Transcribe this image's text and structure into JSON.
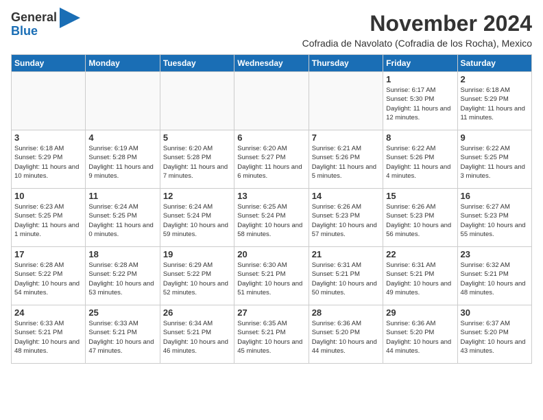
{
  "header": {
    "logo_general": "General",
    "logo_blue": "Blue",
    "title": "November 2024",
    "subtitle": "Cofradia de Navolato (Cofradia de los Rocha), Mexico"
  },
  "weekdays": [
    "Sunday",
    "Monday",
    "Tuesday",
    "Wednesday",
    "Thursday",
    "Friday",
    "Saturday"
  ],
  "weeks": [
    [
      {
        "day": "",
        "info": ""
      },
      {
        "day": "",
        "info": ""
      },
      {
        "day": "",
        "info": ""
      },
      {
        "day": "",
        "info": ""
      },
      {
        "day": "",
        "info": ""
      },
      {
        "day": "1",
        "info": "Sunrise: 6:17 AM\nSunset: 5:30 PM\nDaylight: 11 hours and 12 minutes."
      },
      {
        "day": "2",
        "info": "Sunrise: 6:18 AM\nSunset: 5:29 PM\nDaylight: 11 hours and 11 minutes."
      }
    ],
    [
      {
        "day": "3",
        "info": "Sunrise: 6:18 AM\nSunset: 5:29 PM\nDaylight: 11 hours and 10 minutes."
      },
      {
        "day": "4",
        "info": "Sunrise: 6:19 AM\nSunset: 5:28 PM\nDaylight: 11 hours and 9 minutes."
      },
      {
        "day": "5",
        "info": "Sunrise: 6:20 AM\nSunset: 5:28 PM\nDaylight: 11 hours and 7 minutes."
      },
      {
        "day": "6",
        "info": "Sunrise: 6:20 AM\nSunset: 5:27 PM\nDaylight: 11 hours and 6 minutes."
      },
      {
        "day": "7",
        "info": "Sunrise: 6:21 AM\nSunset: 5:26 PM\nDaylight: 11 hours and 5 minutes."
      },
      {
        "day": "8",
        "info": "Sunrise: 6:22 AM\nSunset: 5:26 PM\nDaylight: 11 hours and 4 minutes."
      },
      {
        "day": "9",
        "info": "Sunrise: 6:22 AM\nSunset: 5:25 PM\nDaylight: 11 hours and 3 minutes."
      }
    ],
    [
      {
        "day": "10",
        "info": "Sunrise: 6:23 AM\nSunset: 5:25 PM\nDaylight: 11 hours and 1 minute."
      },
      {
        "day": "11",
        "info": "Sunrise: 6:24 AM\nSunset: 5:25 PM\nDaylight: 11 hours and 0 minutes."
      },
      {
        "day": "12",
        "info": "Sunrise: 6:24 AM\nSunset: 5:24 PM\nDaylight: 10 hours and 59 minutes."
      },
      {
        "day": "13",
        "info": "Sunrise: 6:25 AM\nSunset: 5:24 PM\nDaylight: 10 hours and 58 minutes."
      },
      {
        "day": "14",
        "info": "Sunrise: 6:26 AM\nSunset: 5:23 PM\nDaylight: 10 hours and 57 minutes."
      },
      {
        "day": "15",
        "info": "Sunrise: 6:26 AM\nSunset: 5:23 PM\nDaylight: 10 hours and 56 minutes."
      },
      {
        "day": "16",
        "info": "Sunrise: 6:27 AM\nSunset: 5:23 PM\nDaylight: 10 hours and 55 minutes."
      }
    ],
    [
      {
        "day": "17",
        "info": "Sunrise: 6:28 AM\nSunset: 5:22 PM\nDaylight: 10 hours and 54 minutes."
      },
      {
        "day": "18",
        "info": "Sunrise: 6:28 AM\nSunset: 5:22 PM\nDaylight: 10 hours and 53 minutes."
      },
      {
        "day": "19",
        "info": "Sunrise: 6:29 AM\nSunset: 5:22 PM\nDaylight: 10 hours and 52 minutes."
      },
      {
        "day": "20",
        "info": "Sunrise: 6:30 AM\nSunset: 5:21 PM\nDaylight: 10 hours and 51 minutes."
      },
      {
        "day": "21",
        "info": "Sunrise: 6:31 AM\nSunset: 5:21 PM\nDaylight: 10 hours and 50 minutes."
      },
      {
        "day": "22",
        "info": "Sunrise: 6:31 AM\nSunset: 5:21 PM\nDaylight: 10 hours and 49 minutes."
      },
      {
        "day": "23",
        "info": "Sunrise: 6:32 AM\nSunset: 5:21 PM\nDaylight: 10 hours and 48 minutes."
      }
    ],
    [
      {
        "day": "24",
        "info": "Sunrise: 6:33 AM\nSunset: 5:21 PM\nDaylight: 10 hours and 48 minutes."
      },
      {
        "day": "25",
        "info": "Sunrise: 6:33 AM\nSunset: 5:21 PM\nDaylight: 10 hours and 47 minutes."
      },
      {
        "day": "26",
        "info": "Sunrise: 6:34 AM\nSunset: 5:21 PM\nDaylight: 10 hours and 46 minutes."
      },
      {
        "day": "27",
        "info": "Sunrise: 6:35 AM\nSunset: 5:21 PM\nDaylight: 10 hours and 45 minutes."
      },
      {
        "day": "28",
        "info": "Sunrise: 6:36 AM\nSunset: 5:20 PM\nDaylight: 10 hours and 44 minutes."
      },
      {
        "day": "29",
        "info": "Sunrise: 6:36 AM\nSunset: 5:20 PM\nDaylight: 10 hours and 44 minutes."
      },
      {
        "day": "30",
        "info": "Sunrise: 6:37 AM\nSunset: 5:20 PM\nDaylight: 10 hours and 43 minutes."
      }
    ]
  ]
}
